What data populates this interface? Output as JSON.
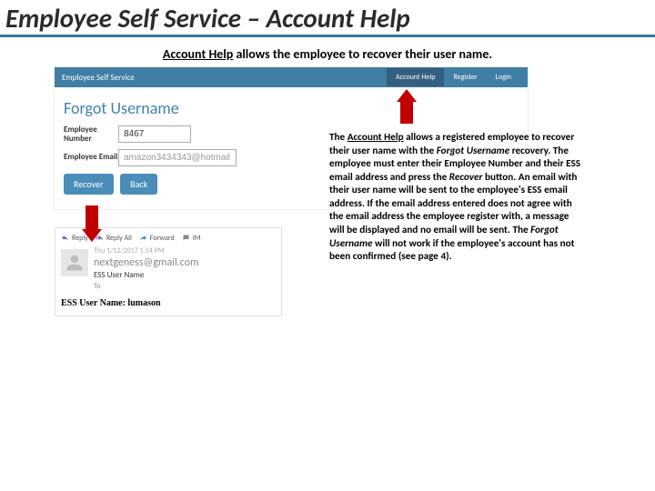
{
  "page": {
    "title": "Employee Self Service – Account Help",
    "subtitle_prefix_underlined": "Account Help",
    "subtitle_rest": " allows the employee to recover their user name."
  },
  "screenshot": {
    "brand": "Employee Self Service",
    "nav_account_help": "Account Help",
    "nav_register": "Register",
    "nav_login": "Login",
    "heading": "Forgot Username",
    "label_emp_no": "Employee Number",
    "label_emp_email": "Employee Email",
    "value_emp_no": "8467",
    "value_emp_email": "amazon3434343@hotmail.com",
    "btn_recover": "Recover",
    "btn_back": "Back"
  },
  "email": {
    "action_reply": "Reply",
    "action_reply_all": "Reply All",
    "action_forward": "Forward",
    "action_im": "IM",
    "date": "Thu 1/12/2017 1:14 PM",
    "from": "nextgeness@gmail.com",
    "subject": "ESS User Name",
    "to": "To",
    "body": "ESS User Name: lumason"
  },
  "explain": {
    "p1_a": "The ",
    "p1_b_u": "Account Help",
    "p1_c": " allows a registered employee to recover their user name with the ",
    "p1_d_i": "Forgot Username",
    "p1_e": " recovery.  The employee must enter their Employee Number and their ESS email address and press the ",
    "p1_f_i": "Recover",
    "p1_g": " button.  An email with their user name will be sent to the employee's ESS email address.  If the email address entered does not agree with the email address the employee register with, a message will be displayed and no email will be sent.  The ",
    "p1_h_i": "Forgot Username",
    "p1_i": " will not work if the employee's account has not been confirmed (see page 4)."
  }
}
